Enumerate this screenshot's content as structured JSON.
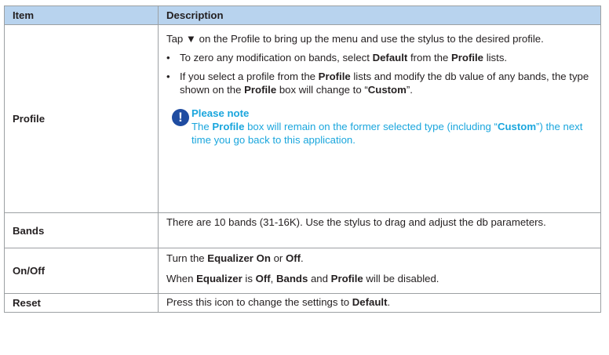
{
  "header": {
    "item": "Item",
    "description": "Description"
  },
  "profile": {
    "label": "Profile",
    "intro": "Tap ▼ on the Profile to bring up the menu and use the stylus to the desired profile.",
    "bullet_glyph": "•",
    "bullet1": {
      "t1": "To zero any modification on bands, select ",
      "b1": "Default",
      "t2": " from the ",
      "b2": "Profile",
      "t3": " lists."
    },
    "bullet2": {
      "t1": "If you select a profile from the ",
      "b1": "Profile",
      "t2": " lists and modify the db value of any bands, the type shown on the ",
      "b2": "Profile",
      "t3": " box will change to “",
      "b3": "Custom",
      "t4": "”."
    },
    "note": {
      "icon": "!",
      "title": "Please note",
      "t1": "The ",
      "b1": "Profile",
      "t2": " box will remain on the former selected type (including “",
      "b2": "Custom",
      "t3": "”) the next time you go back to this application."
    }
  },
  "bands": {
    "label": "Bands",
    "text": "There are 10 bands (31-16K). Use the stylus to drag and adjust the db parameters."
  },
  "onoff": {
    "label": "On/Off",
    "line1": {
      "t1": "Turn the ",
      "b1": "Equalizer On",
      "t2": " or ",
      "b2": "Off",
      "t3": "."
    },
    "line2": {
      "t1": "When ",
      "b1": "Equalizer",
      "t2": " is ",
      "b2": "Off",
      "t3": ", ",
      "b3": "Bands",
      "t4": " and ",
      "b4": "Profile",
      "t5": " will be disabled."
    }
  },
  "reset": {
    "label": "Reset",
    "line": {
      "t1": "Press this icon to change the settings to ",
      "b1": "Default",
      "t2": "."
    }
  },
  "colors": {
    "header_bg": "#b8d3ee",
    "border": "#9ca0a3",
    "note_text": "#1aa6dd",
    "note_icon_bg": "#1f4ca1"
  }
}
